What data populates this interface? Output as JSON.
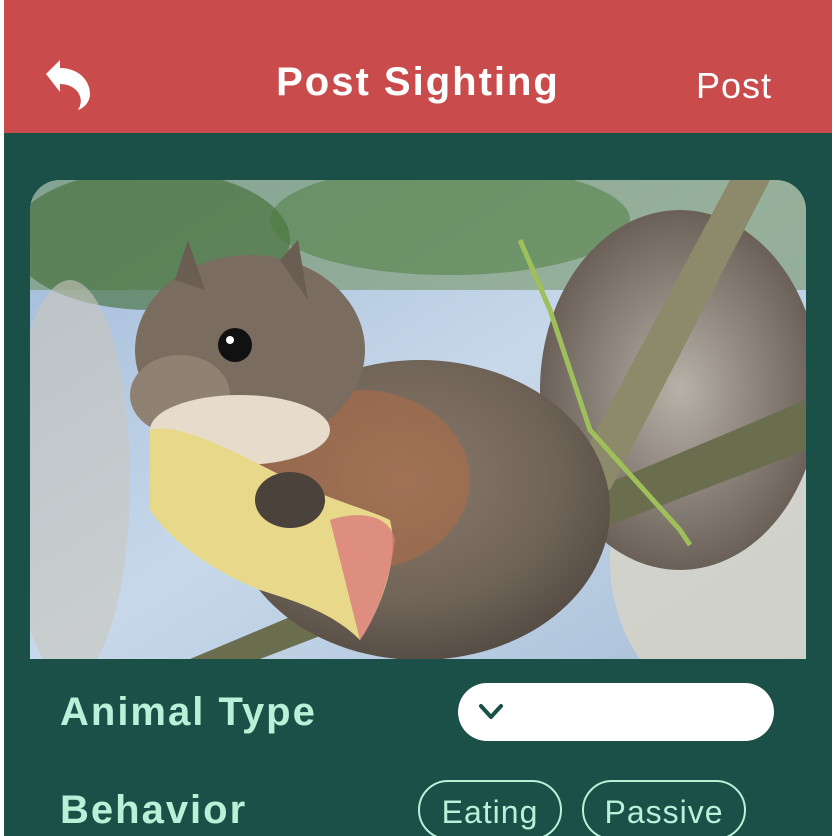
{
  "header": {
    "title": "Post Sighting",
    "post_label": "Post",
    "back_icon": "back-arrow-icon",
    "background_color": "#c94b4b"
  },
  "photo": {
    "subject": "squirrel-photo"
  },
  "form": {
    "animal_type": {
      "label": "Animal Type",
      "selected_value": "",
      "dropdown_icon": "chevron-down-icon"
    },
    "behavior": {
      "label": "Behavior",
      "chips": [
        "Eating",
        "Passive"
      ]
    }
  },
  "colors": {
    "background": "#1b5049",
    "accent_text": "#b8f0d8",
    "header": "#c94b4b"
  }
}
